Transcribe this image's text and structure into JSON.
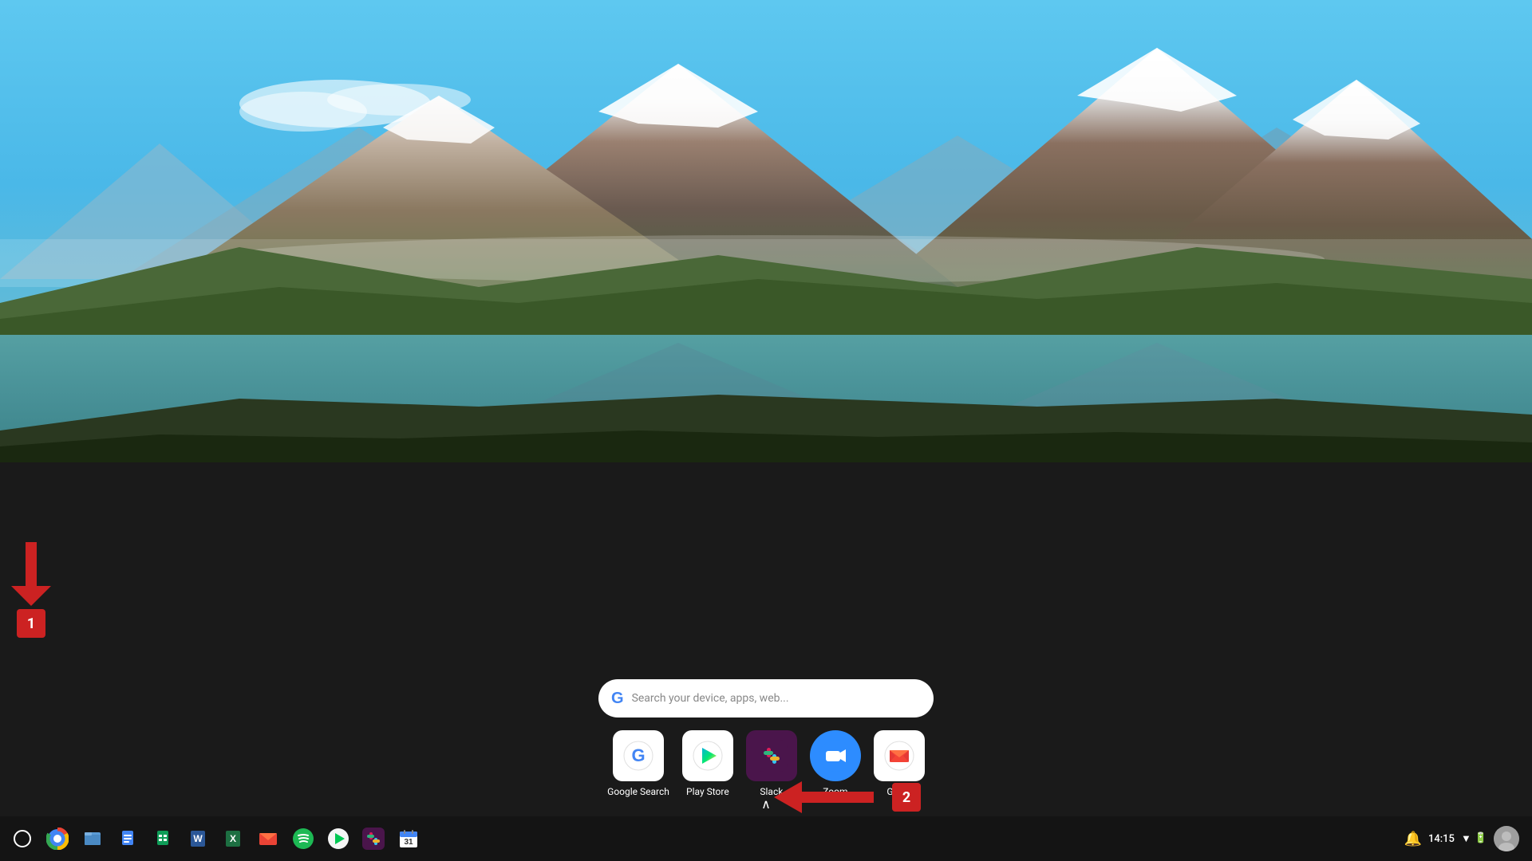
{
  "wallpaper": {
    "alt": "Mountain lake landscape with snow-capped peaks"
  },
  "search": {
    "placeholder": "Search your device, apps, web...",
    "g_logo": "G"
  },
  "launcher": {
    "apps": [
      {
        "id": "google-search",
        "label": "Google Search",
        "icon_text": "G",
        "icon_color": "#4285f4",
        "bg": "#ffffff"
      },
      {
        "id": "play-store",
        "label": "Play Store",
        "icon_text": "▶",
        "bg": "#ffffff"
      },
      {
        "id": "slack",
        "label": "Slack",
        "icon_text": "S",
        "bg": "#4a154b"
      },
      {
        "id": "zoom",
        "label": "Zoom",
        "icon_text": "Z",
        "bg": "#2d8cff"
      },
      {
        "id": "gmail",
        "label": "Gmail",
        "icon_text": "M",
        "bg": "#ffffff"
      }
    ]
  },
  "shelf": {
    "apps": [
      {
        "id": "launcher",
        "icon": "○",
        "color": "#ffffff"
      },
      {
        "id": "chrome",
        "icon": "⬤",
        "color": "#4285f4"
      },
      {
        "id": "files",
        "icon": "📁",
        "color": "#5b9bd5"
      },
      {
        "id": "docs",
        "icon": "📄",
        "color": "#4285f4"
      },
      {
        "id": "sheets",
        "icon": "📊",
        "color": "#0f9d58"
      },
      {
        "id": "word",
        "icon": "W",
        "color": "#2b5797"
      },
      {
        "id": "excel",
        "icon": "X",
        "color": "#1d6f42"
      },
      {
        "id": "gmail-shelf",
        "icon": "M",
        "color": "#ea4335"
      },
      {
        "id": "spotify",
        "icon": "♫",
        "color": "#1db954"
      },
      {
        "id": "play-shelf",
        "icon": "▶",
        "color": "#00c853"
      },
      {
        "id": "slack-shelf",
        "icon": "S",
        "color": "#4a154b"
      },
      {
        "id": "calendar",
        "icon": "31",
        "color": "#4285f4"
      }
    ],
    "time": "14:15",
    "status_icons": [
      "🔔",
      "▼",
      "🔋"
    ]
  },
  "annotations": [
    {
      "id": "arrow-1",
      "number": "1",
      "direction": "down"
    },
    {
      "id": "arrow-2",
      "number": "2",
      "direction": "left"
    }
  ]
}
